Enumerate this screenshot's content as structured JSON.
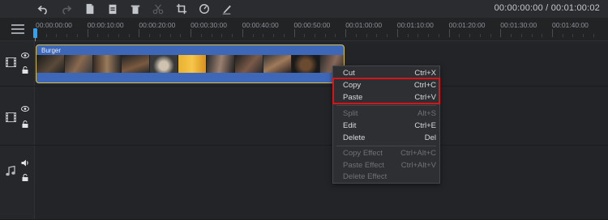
{
  "toolbar": {
    "icons": [
      "undo-icon",
      "redo-icon",
      "document-icon",
      "clipboard-icon",
      "trash-icon",
      "scissors-icon",
      "crop-icon",
      "speed-icon",
      "edit-pen-icon"
    ],
    "timecode": "00:00:00:00 / 00:01:00:02"
  },
  "ruler": {
    "labels": [
      "00:00:00:00",
      "00:00:10:00",
      "00:00:20:00",
      "00:00:30:00",
      "00:00:40:00",
      "00:00:50:00",
      "00:01:00:00",
      "00:01:10:00",
      "00:01:20:00",
      "00:01:30:00",
      "00:01:40:00"
    ]
  },
  "tracks": [
    {
      "type": "video",
      "icons": [
        "film-icon",
        "eye-icon",
        "lock-icon"
      ]
    },
    {
      "type": "video",
      "icons": [
        "film-icon",
        "eye-icon",
        "lock-icon"
      ]
    },
    {
      "type": "audio",
      "icons": [
        "music-note-icon",
        "speaker-icon",
        "lock-icon"
      ]
    }
  ],
  "clip": {
    "name": "Burger"
  },
  "context_menu": {
    "items": [
      {
        "label": "Cut",
        "shortcut": "Ctrl+X",
        "enabled": true
      },
      {
        "label": "Copy",
        "shortcut": "Ctrl+C",
        "enabled": true
      },
      {
        "label": "Paste",
        "shortcut": "Ctrl+V",
        "enabled": true
      },
      {
        "label": "Split",
        "shortcut": "Alt+S",
        "enabled": false
      },
      {
        "label": "Edit",
        "shortcut": "Ctrl+E",
        "enabled": true
      },
      {
        "label": "Delete",
        "shortcut": "Del",
        "enabled": true
      },
      {
        "label": "Copy Effect",
        "shortcut": "Ctrl+Alt+C",
        "enabled": false
      },
      {
        "label": "Paste Effect",
        "shortcut": "Ctrl+Alt+V",
        "enabled": false
      },
      {
        "label": "Delete Effect",
        "shortcut": "",
        "enabled": false
      }
    ]
  },
  "highlight_color": "#d4161b",
  "accent_color": "#29a3ff"
}
